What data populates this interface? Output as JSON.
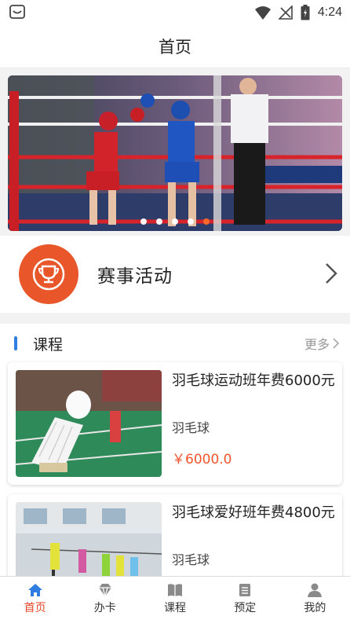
{
  "status_bar": {
    "time": "4:24"
  },
  "header": {
    "title": "首页"
  },
  "banner": {
    "slide_count": 5,
    "active_index": 4
  },
  "event": {
    "label": "赛事活动"
  },
  "courses": {
    "section_title": "课程",
    "more_label": "更多",
    "items": [
      {
        "title": "羽毛球运动班年费6000元",
        "category": "羽毛球",
        "price": "￥6000.0"
      },
      {
        "title": "羽毛球爱好班年费4800元",
        "category": "羽毛球"
      }
    ]
  },
  "tabbar": {
    "items": [
      {
        "label": "首页",
        "icon": "home-icon",
        "active": true
      },
      {
        "label": "办卡",
        "icon": "diamond-card-icon",
        "active": false
      },
      {
        "label": "课程",
        "icon": "book-icon",
        "active": false
      },
      {
        "label": "预定",
        "icon": "clipboard-icon",
        "active": false
      },
      {
        "label": "我的",
        "icon": "person-icon",
        "active": false
      }
    ]
  },
  "colors": {
    "accent": "#e8562a",
    "price": "#f0552e",
    "section_bar": "#2f7de1"
  }
}
